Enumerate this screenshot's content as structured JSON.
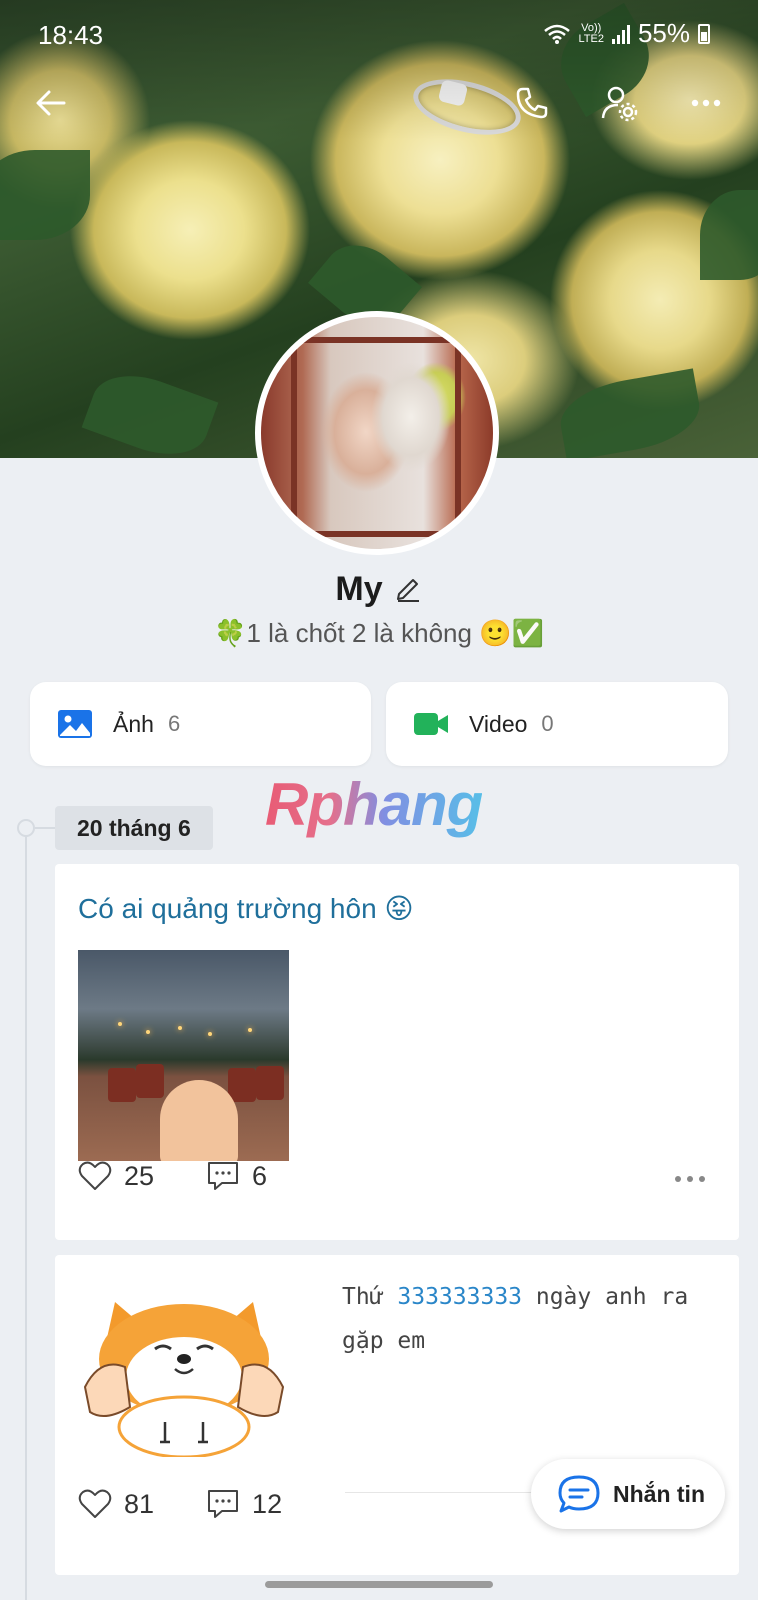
{
  "status_bar": {
    "time": "18:43",
    "network_top": "Vo))",
    "network_bottom": "LTE2",
    "battery": "55%"
  },
  "profile": {
    "name": "My",
    "bio": "🍀1 là chốt 2 là không 🙂✅"
  },
  "media": {
    "photos": {
      "label": "Ảnh",
      "count": "6",
      "icon": "image-icon",
      "color": "#1a73e8"
    },
    "videos": {
      "label": "Video",
      "count": "0",
      "icon": "video-icon",
      "color": "#22b25a"
    }
  },
  "watermark": "Rphang",
  "timeline": {
    "date": "20 tháng 6",
    "posts": [
      {
        "title": "Có ai quảng trường hôn 😝",
        "likes": "25",
        "comments": "6"
      },
      {
        "caption_prefix": "Thứ ",
        "caption_highlight": "333333333",
        "caption_suffix": " ngày anh ra gặp em",
        "likes": "81",
        "comments": "12"
      }
    ]
  },
  "fab": {
    "label": "Nhắn tin"
  },
  "colors": {
    "accent_blue": "#1f6f9b",
    "highlight_blue": "#2a86c8",
    "background": "#eceff3"
  }
}
